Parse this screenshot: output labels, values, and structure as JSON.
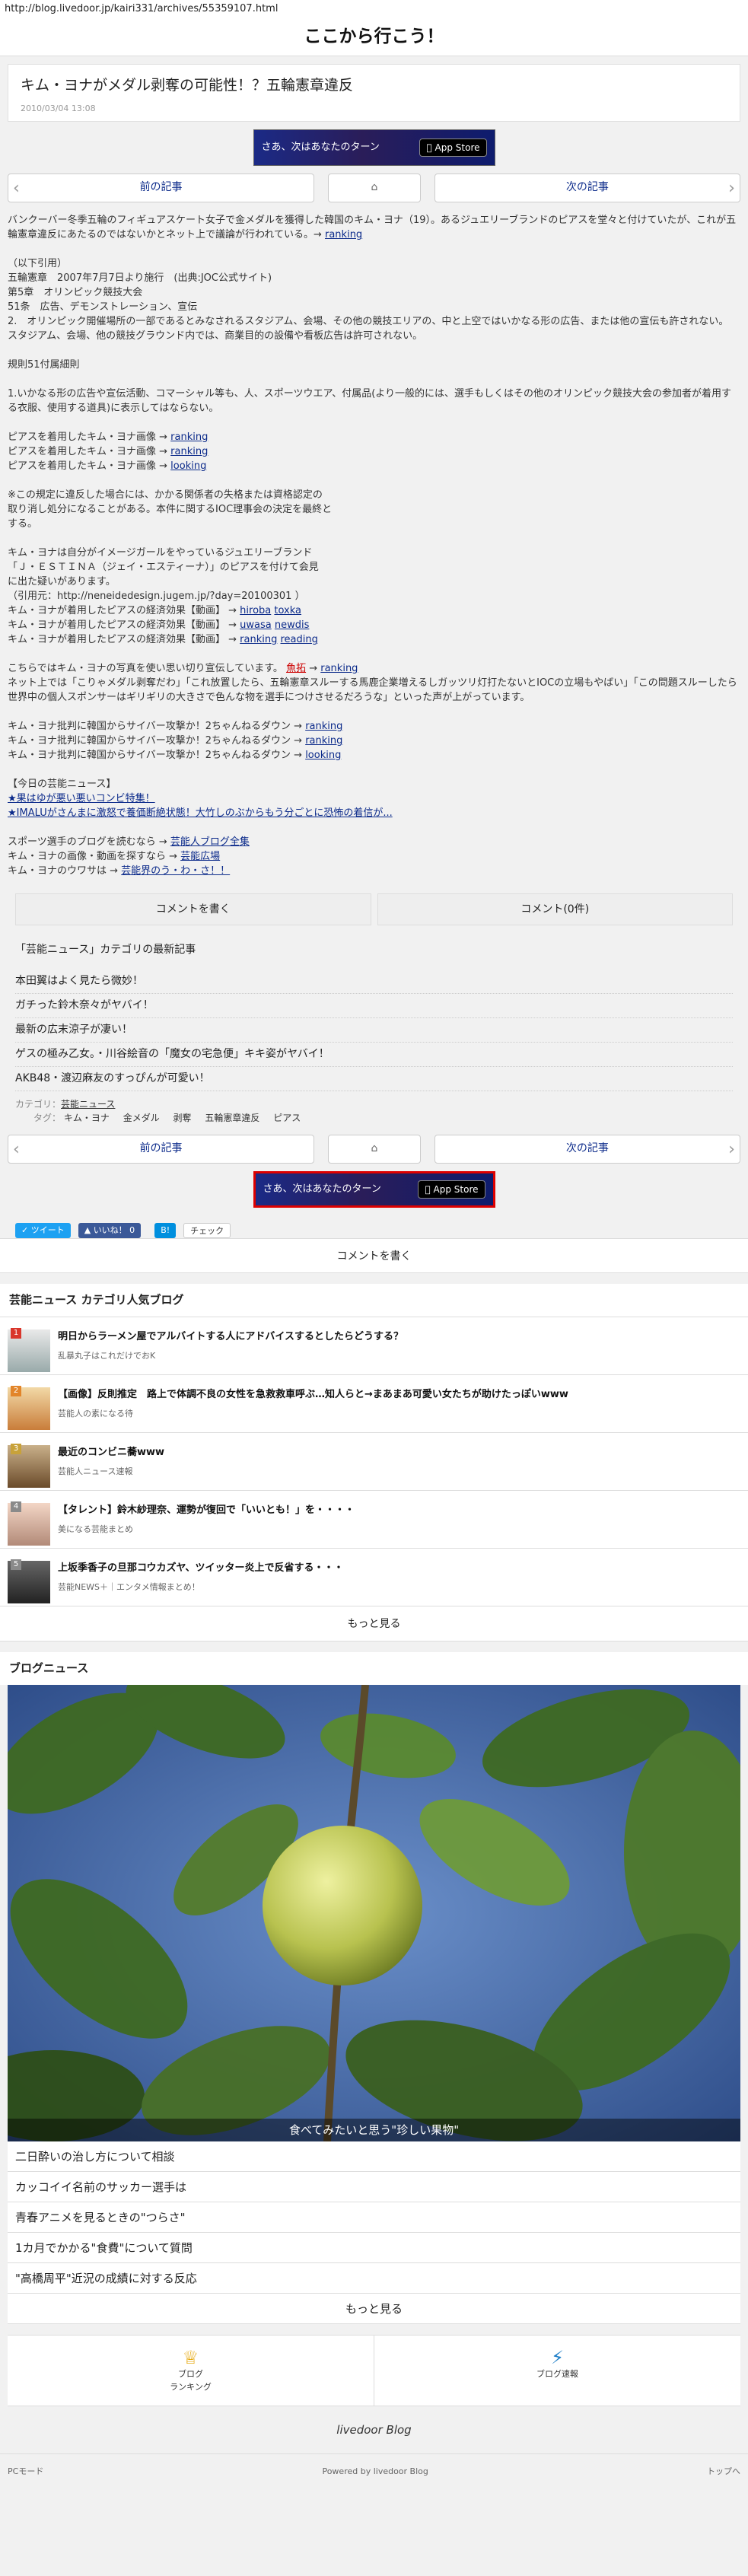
{
  "browser": {
    "url": "http://blog.livedoor.jp/kairi331/archives/55359107.html"
  },
  "site": {
    "title": "ここから行こう！"
  },
  "article": {
    "title": "キム・ヨナがメダル剥奪の可能性！？五輪憲章違反",
    "date": "2010/03/04 13:08",
    "p1": "バンクーバー冬季五輪のフィギュアスケート女子で金メダルを獲得した韓国のキム・ヨナ（19）。あるジュエリーブランドのピアスを堂々と付けていたが、これが五輪憲章違反にあたるのではないかとネット上で議論が行われている。→",
    "p1_link": "ranking",
    "quote_lines": [
      "（以下引用）",
      "五輪憲章　2007年7月7日より施行　(出典:JOC公式サイト)",
      "第5章　オリンピック競技大会",
      "51条　広告、デモンストレーション、宣伝",
      "2.　オリンピック開催場所の一部であるとみなされるスタジアム、会場、その他の競技エリアの、中と上空ではいかなる形の広告、または他の宣伝も許されない。",
      "スタジアム、会場、他の競技グラウンド内では、商業目的の設備や看板広告は許可されない。"
    ],
    "rule_title": "規則51付属細則",
    "rule_text": "1.いかなる形の広告や宣伝活動、コマーシャル等も、人、スポーツウエア、付属品(より一般的には、選手もしくはその他のオリンピック競技大会の参加者が着用する衣服、使用する道具)に表示してはならない。",
    "pierce_lines": [
      "ピアスを着用したキム・ヨナ画像 →",
      "ピアスを着用したキム・ヨナ画像 →",
      "ピアスを着用したキム・ヨナ画像 →"
    ],
    "pierce_links": [
      "ranking",
      "ranking",
      "looking"
    ],
    "note_lines": [
      "※この規定に違反した場合には、かかる関係者の失格または資格認定の",
      "取り消し処分になることがある。本件に関するIOC理事会の決定を最終と",
      "する。"
    ],
    "jewel_lines": [
      "キム・ヨナは自分がイメージガールをやっているジュエリーブランド",
      "「Ｊ・ＥＳＴＩＮＡ（ジェイ・エスティーナ）」のピアスを付けて会見",
      "に出た疑いがあります。",
      "（引用元：http://neneidedesign.jugem.jp/?day=20100301 ）"
    ],
    "effect_lines": [
      "キム・ヨナが着用したピアスの経済効果【動画】 →",
      "キム・ヨナが着用したピアスの経済効果【動画】 →",
      "キム・ヨナが着用したピアスの経済効果【動画】 →"
    ],
    "effect_links": [
      [
        "hiroba",
        "toxka"
      ],
      [
        "uwasa",
        "newdis"
      ],
      [
        "ranking",
        "reading"
      ]
    ],
    "photo_line": "こちらではキム・ヨナの写真を使い思い切り宣伝しています。",
    "photo_links": [
      "魚拓",
      "ranking"
    ],
    "net_text": "ネット上では「こりゃメダル剥奪だわ」「これ放置したら、五輪憲章スルーする馬鹿企業増えるしガッツリ灯打たないとIOCの立場もやばい」「この問題スルーしたら世界中の個人スポンサーはギリギリの大きさで色んな物を選手につけさせるだろうな」といった声が上がっています。",
    "cyber_lines": [
      "キム・ヨナ批判に韓国からサイバー攻撃か！2ちゃんねるダウン →",
      "キム・ヨナ批判に韓国からサイバー攻撃か！2ちゃんねるダウン →",
      "キム・ヨナ批判に韓国からサイバー攻撃か！2ちゃんねるダウン →"
    ],
    "cyber_links": [
      "ranking",
      "ranking",
      "looking"
    ],
    "today_title": "【今日の芸能ニュース】",
    "today_items": [
      "★果はゆが悪い悪いコンビ特集！",
      "★IMALUがさんまに激怒で養価断絶状態！大竹しのぶからもう分ごとに恐怖の着信が..."
    ],
    "more_lines": [
      "スポーツ選手のブログを読むなら →",
      "キム・ヨナの画像・動画を探すなら →",
      "キム・ヨナのウワサは →"
    ],
    "more_links": [
      "芸能人ブログ全集",
      "芸能広場",
      "芸能界のう・わ・さ！！"
    ]
  },
  "nav": {
    "prev": "前の記事",
    "next": "次の記事"
  },
  "banner": {
    "text": "さあ、次はあなたのターン",
    "store": "App Store"
  },
  "comments": {
    "write": "コメントを書く",
    "count": "コメント(0件)"
  },
  "category": {
    "heading": "「芸能ニュース」カテゴリの最新記事",
    "items": [
      "本田翼はよく見たら微妙！",
      "ガチった鈴木奈々がヤバイ！",
      "最新の広末涼子が凄い！",
      "ゲスの極み乙女。・川谷絵音の「魔女の宅急便」キキ姿がヤバイ！",
      "AKB48・渡辺麻友のすっぴんが可愛い！"
    ],
    "cat_label": "カテゴリ：",
    "cat_value": "芸能ニュース",
    "tag_label": "タグ：",
    "tags": [
      "キム・ヨナ",
      "金メダル",
      "剥奪",
      "五輪憲章違反",
      "ピアス"
    ]
  },
  "share": {
    "tweet": "ツイート",
    "like": "いいね！ 0",
    "hatena": "B!",
    "mixi": "チェック"
  },
  "popular": {
    "heading": "芸能ニュース カテゴリ人気ブログ",
    "items": [
      {
        "rank": "1",
        "title": "明日からラーメン屋でアルバイトする人にアドバイスするとしたらどうする？",
        "source": "乱暴丸子はこれだけでおK"
      },
      {
        "rank": "2",
        "title": "【画像】反則推定　路上で体調不良の女性を急救救車呼ぶ…知人らと→まあまあ可愛い女たちが助けたっぽいwww",
        "source": "芸能人の素になる待"
      },
      {
        "rank": "3",
        "title": "最近のコンビニ蕎www",
        "source": "芸能人ニュース速報"
      },
      {
        "rank": "4",
        "title": "【タレント】鈴木紗理奈、運勢が復回で「いいとも！」を・・・・",
        "source": "美になる芸能まとめ"
      },
      {
        "rank": "5",
        "title": "上坂季香子の旦那コウカズヤ、ツイッター炎上で反省する・・・",
        "source": "芸能NEWS＋｜エンタメ情報まとめ！"
      }
    ],
    "more": "もっと見る"
  },
  "blognews": {
    "heading": "ブログニュース",
    "photo_caption": "食べてみたいと思う\"珍しい果物\"",
    "items": [
      "二日酔いの治し方について相談",
      "カッコイイ名前のサッカー選手は",
      "青春アニメを見るときの\"つらさ\"",
      "1カ月でかかる\"食費\"について質問",
      "\"高橋周平\"近況の成績に対する反応"
    ],
    "more": "もっと見る"
  },
  "bottom": {
    "ranking": "ブログ\nランキング",
    "speed": "ブログ速報"
  },
  "logo": {
    "text": "livedoor Blog"
  },
  "footer": {
    "pc": "PCモード",
    "powered": "Powered by livedoor Blog",
    "top": "トップへ"
  }
}
